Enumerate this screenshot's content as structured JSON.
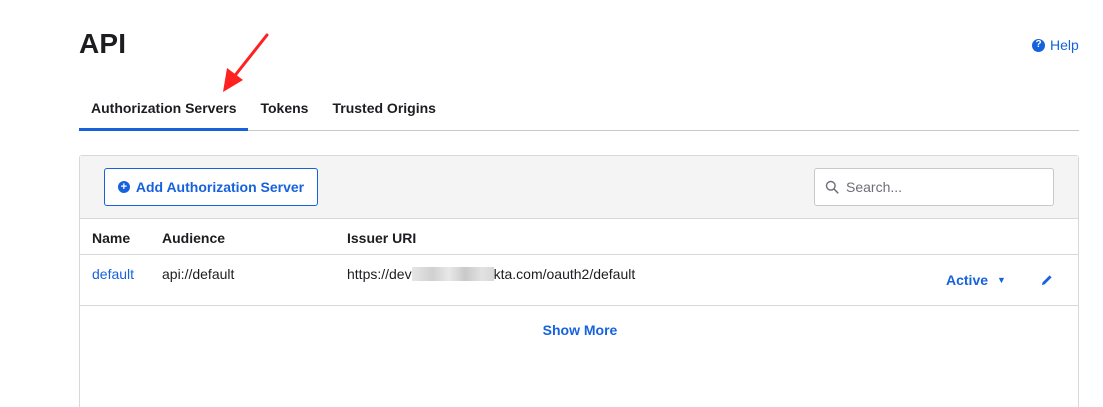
{
  "page": {
    "title": "API"
  },
  "help": {
    "label": "Help",
    "icon": "help-circle-icon"
  },
  "tabs": [
    {
      "label": "Authorization Servers",
      "active": true
    },
    {
      "label": "Tokens",
      "active": false
    },
    {
      "label": "Trusted Origins",
      "active": false
    }
  ],
  "toolbar": {
    "add_button_label": "Add Authorization Server",
    "search_placeholder": "Search..."
  },
  "table": {
    "columns": [
      "Name",
      "Audience",
      "Issuer URI"
    ],
    "rows": [
      {
        "name": "default",
        "audience": "api://default",
        "issuer_prefix": "https://dev",
        "issuer_suffix": "kta.com/oauth2/default",
        "status": "Active"
      }
    ]
  },
  "footer": {
    "show_more_label": "Show More"
  },
  "colors": {
    "accent": "#1662dd",
    "annotation": "#ff2020",
    "toolbar_bg": "#f4f4f4"
  }
}
